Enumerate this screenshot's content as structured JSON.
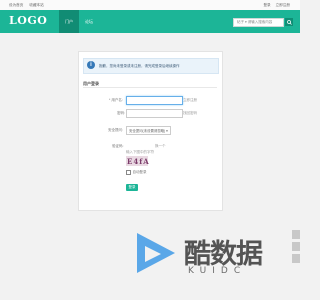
{
  "topbar": {
    "left_links": [
      "设为首页",
      "收藏本站"
    ],
    "right_links": [
      "登录",
      "立即注册"
    ]
  },
  "header": {
    "logo": "LOGO",
    "nav": [
      {
        "label": "门户",
        "active": true
      },
      {
        "label": "论坛",
        "active": false
      }
    ],
    "search_placeholder": "帖子 ▾ 请输入搜索内容",
    "accent_color": "#1cb597"
  },
  "notice": {
    "icon": "i",
    "text": "抱歉，您尚未登录或未注册，请完成登录后继续操作"
  },
  "form": {
    "section_title": "用户登录",
    "username_label": "* 用户名:",
    "register_link": "立即注册",
    "password_label": "密码:",
    "forgot_link": "找回密码",
    "question_label": "安全提问:",
    "question_value": "安全提问(未设置请忽略) ▾",
    "captcha_label": "验证码:",
    "captcha_refresh": "换一个",
    "captcha_hint": "输入下图中的字符",
    "captcha_code": "E4fA",
    "remember_label": "自动登录",
    "submit_label": "登录"
  },
  "watermark": {
    "brand": "酷数据",
    "sub": "KUIDC"
  }
}
